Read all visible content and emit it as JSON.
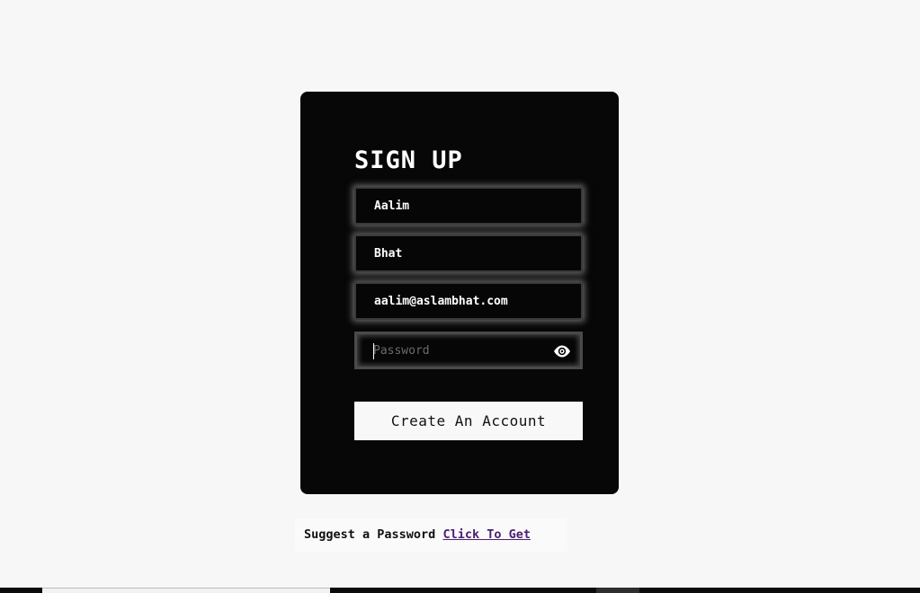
{
  "form": {
    "title": "SIGN UP",
    "first_name": {
      "value": "Aalim"
    },
    "last_name": {
      "value": "Bhat"
    },
    "email": {
      "value": "aalim@aslambhat.com"
    },
    "password": {
      "value": "",
      "placeholder": "Password"
    },
    "eye_icon": "eye-icon",
    "submit_label": "Create An Account"
  },
  "suggest": {
    "text": "Suggest a Password",
    "link_label": "Click To Get",
    "link_color": "#4b1f73"
  },
  "colors": {
    "page_bg": "#f7f7f7",
    "card_bg": "#070707",
    "button_bg": "#f8f8f8"
  }
}
